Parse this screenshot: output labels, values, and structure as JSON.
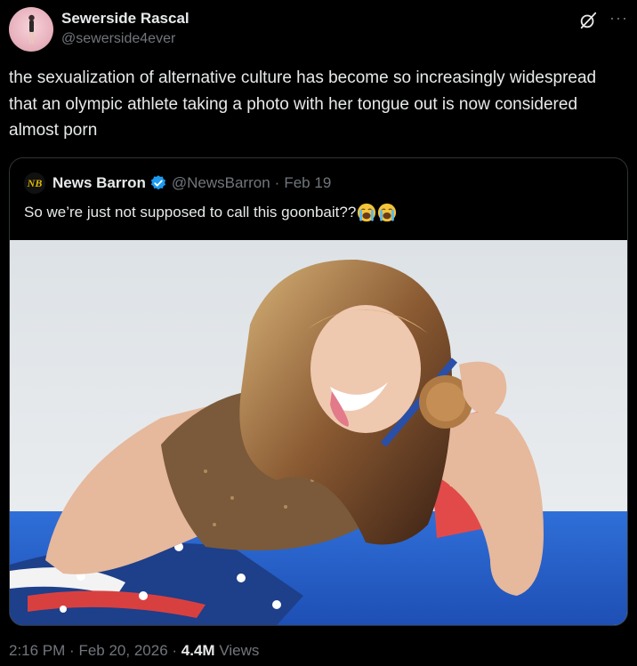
{
  "author": {
    "display_name": "Sewerside Rascal",
    "handle": "@sewerside4ever",
    "avatar_icon": "profile-photo"
  },
  "tweet": {
    "text": "the sexualization of alternative culture has become so increasingly widespread that an olympic athlete taking a photo with her tongue out is now considered almost porn"
  },
  "quoted_tweet": {
    "avatar_text": "NB",
    "display_name": "News Barron",
    "handle": "@NewsBarron",
    "separator": "·",
    "date": "Feb 19",
    "text": "So we’re just not supposed to call this goonbait??",
    "emojis": [
      "loudly-crying-face",
      "loudly-crying-face"
    ],
    "media": "photo-figure-skater-with-bronze-medal-on-us-flag"
  },
  "meta": {
    "time": "2:16 PM",
    "separator1": "·",
    "date": "Feb 20, 2026",
    "separator2": "·",
    "views_count": "4.4M",
    "views_label": "Views"
  },
  "colors": {
    "background": "#000000",
    "text_primary": "#e7e9ea",
    "text_secondary": "#71767b",
    "border": "#2f3336",
    "verified_blue": "#1d9bf0"
  }
}
